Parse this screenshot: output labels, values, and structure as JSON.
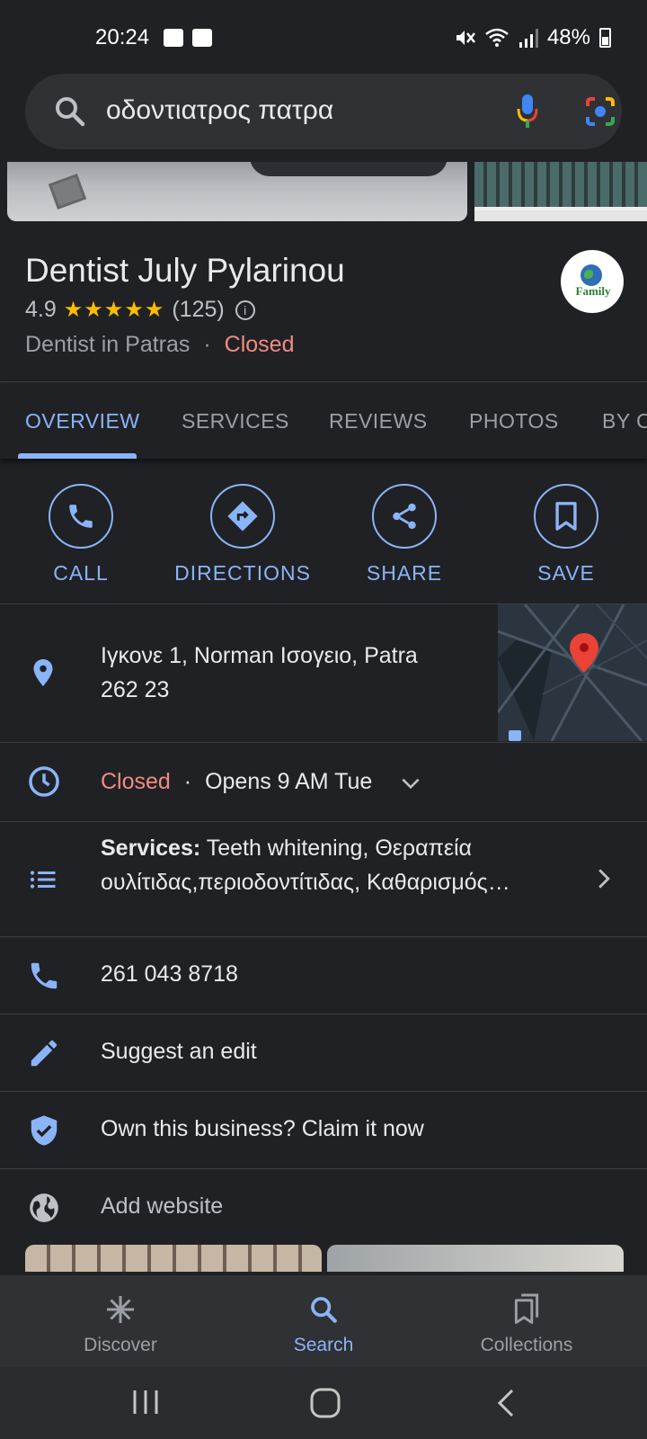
{
  "status_bar": {
    "time": "20:24",
    "battery": "48%"
  },
  "search": {
    "query": "οδοντιατρος πατρα"
  },
  "place": {
    "name": "Dentist July Pylarinou",
    "rating": "4.9",
    "stars": "★★★★★",
    "review_count": "(125)",
    "category": "Dentist in Patras",
    "separator": "·",
    "status": "Closed",
    "logo_text": "Family"
  },
  "tabs": [
    "OVERVIEW",
    "SERVICES",
    "REVIEWS",
    "PHOTOS",
    "BY O"
  ],
  "actions": [
    {
      "label": "CALL",
      "icon": "phone-icon"
    },
    {
      "label": "DIRECTIONS",
      "icon": "directions-icon"
    },
    {
      "label": "SHARE",
      "icon": "share-icon"
    },
    {
      "label": "SAVE",
      "icon": "bookmark-icon"
    }
  ],
  "address": {
    "line1": "Ιγκονε 1, Norman Ισογειο, Patra",
    "line2": "262 23"
  },
  "hours": {
    "status": "Closed",
    "separator": "·",
    "next": "Opens 9 AM Tue"
  },
  "services": {
    "label": "Services:",
    "line1": "Teeth whitening, Θεραπεία",
    "line2": "ουλίτιδας,περιοδοντίτιδας, Καθαρισμός…"
  },
  "phone": "261 043 8718",
  "suggest_edit": "Suggest an edit",
  "claim": "Own this business? Claim it now",
  "website": "Add website",
  "bottom_nav": [
    {
      "label": "Discover",
      "icon": "asterisk-icon"
    },
    {
      "label": "Search",
      "icon": "search-icon"
    },
    {
      "label": "Collections",
      "icon": "collections-icon"
    }
  ],
  "colors": {
    "accent": "#8ab4f8",
    "closed": "#f28b82",
    "star": "#fbbc04",
    "background": "#202124"
  }
}
